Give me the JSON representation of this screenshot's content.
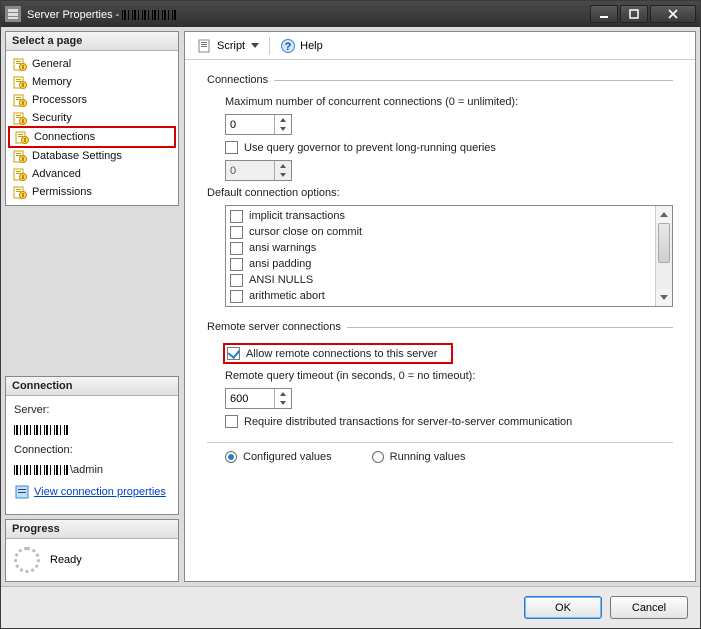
{
  "window": {
    "title": "Server Properties - "
  },
  "left": {
    "select_page": {
      "header": "Select a page",
      "items": [
        "General",
        "Memory",
        "Processors",
        "Security",
        "Connections",
        "Database Settings",
        "Advanced",
        "Permissions"
      ],
      "highlighted_index": 4
    },
    "connection": {
      "header": "Connection",
      "server_label": "Server:",
      "connection_label": "Connection:",
      "connection_value_suffix": "\\admin",
      "link": "View connection properties"
    },
    "progress": {
      "header": "Progress",
      "status": "Ready"
    }
  },
  "toolbar": {
    "script": "Script",
    "help": "Help"
  },
  "main": {
    "connections": {
      "legend": "Connections",
      "max_label": "Maximum number of concurrent connections (0 = unlimited):",
      "max_value": "0",
      "governor_label": "Use query governor to prevent long-running queries",
      "governor_checked": false,
      "governor_value": "0",
      "default_opts_label": "Default connection options:",
      "options": [
        "implicit transactions",
        "cursor close on commit",
        "ansi warnings",
        "ansi padding",
        "ANSI NULLS",
        "arithmetic abort"
      ]
    },
    "remote": {
      "legend": "Remote server connections",
      "allow_label": "Allow remote connections to this server",
      "allow_checked": true,
      "timeout_label": "Remote query timeout (in seconds, 0 = no timeout):",
      "timeout_value": "600",
      "dtc_label": "Require distributed transactions for server-to-server communication",
      "dtc_checked": false
    },
    "radios": {
      "configured": "Configured values",
      "running": "Running values",
      "selected": "configured"
    }
  },
  "footer": {
    "ok": "OK",
    "cancel": "Cancel"
  }
}
